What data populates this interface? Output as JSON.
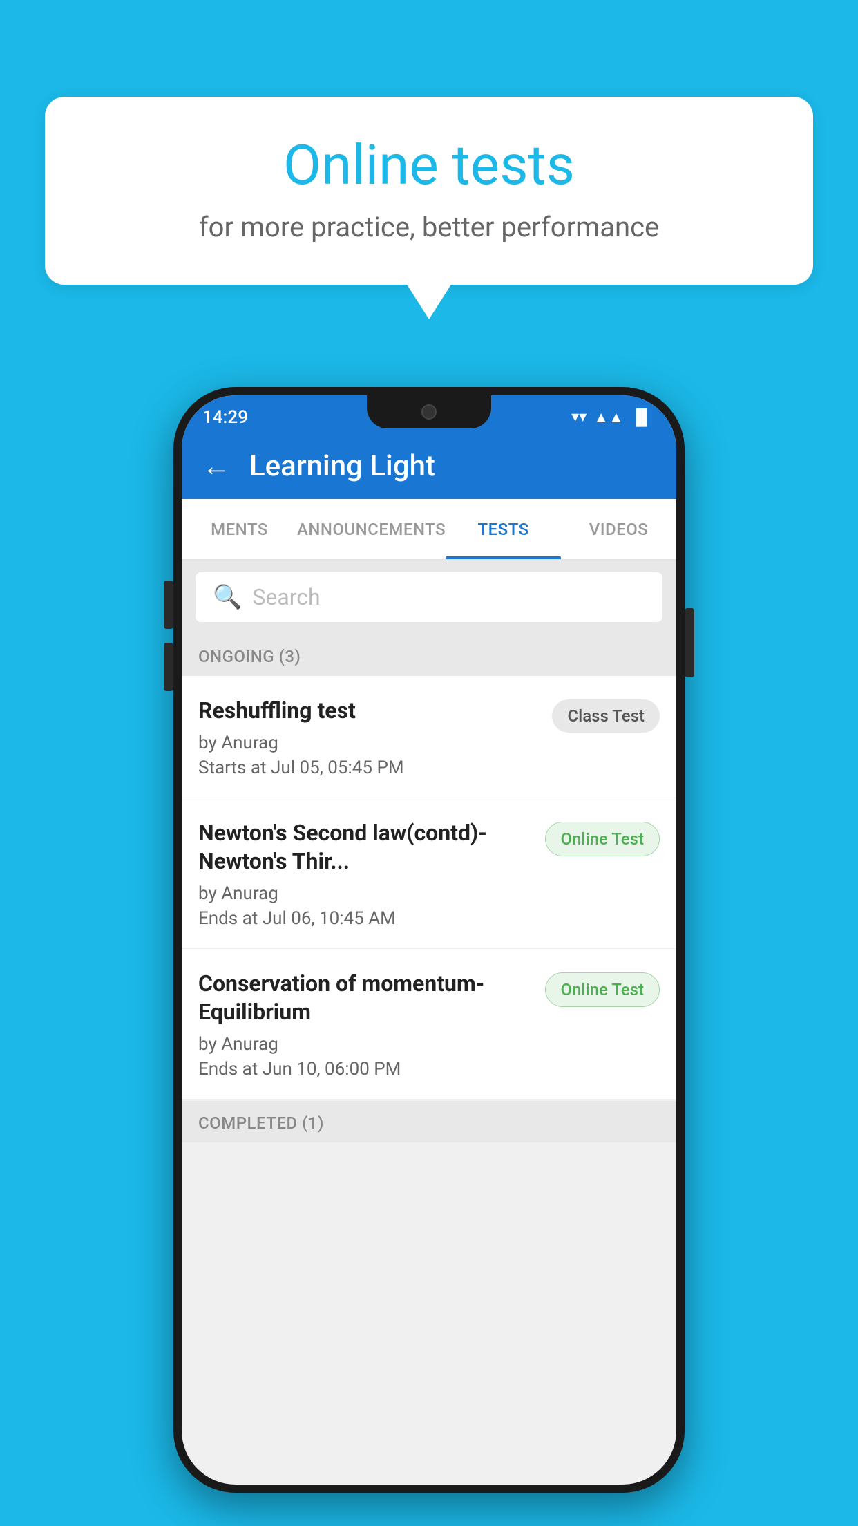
{
  "background_color": "#1BB8E8",
  "bubble": {
    "title": "Online tests",
    "subtitle": "for more practice, better performance"
  },
  "phone": {
    "status_bar": {
      "time": "14:29",
      "wifi_icon": "▼",
      "signal_icon": "▲",
      "battery_icon": "▐"
    },
    "app_bar": {
      "title": "Learning Light",
      "back_label": "←"
    },
    "tabs": [
      {
        "label": "MENTS",
        "active": false
      },
      {
        "label": "ANNOUNCEMENTS",
        "active": false
      },
      {
        "label": "TESTS",
        "active": true
      },
      {
        "label": "VIDEOS",
        "active": false
      }
    ],
    "search": {
      "placeholder": "Search"
    },
    "sections": [
      {
        "label": "ONGOING (3)",
        "tests": [
          {
            "name": "Reshuffling test",
            "author": "by Anurag",
            "time_label": "Starts at",
            "time": "Jul 05, 05:45 PM",
            "badge": "Class Test",
            "badge_type": "class"
          },
          {
            "name": "Newton's Second law(contd)-Newton's Thir...",
            "author": "by Anurag",
            "time_label": "Ends at",
            "time": "Jul 06, 10:45 AM",
            "badge": "Online Test",
            "badge_type": "online"
          },
          {
            "name": "Conservation of momentum-Equilibrium",
            "author": "by Anurag",
            "time_label": "Ends at",
            "time": "Jun 10, 06:00 PM",
            "badge": "Online Test",
            "badge_type": "online"
          }
        ]
      }
    ],
    "completed_section_label": "COMPLETED (1)"
  }
}
